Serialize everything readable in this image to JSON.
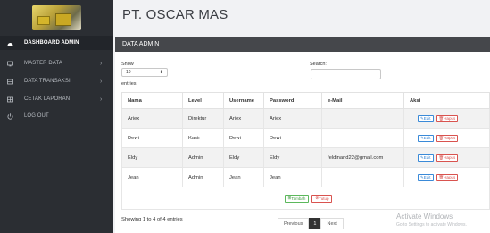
{
  "app": {
    "title": "PT. OSCAR MAS"
  },
  "sidebar": {
    "items": [
      {
        "label": "DASHBOARD ADMIN",
        "icon": "dashboard-icon",
        "active": true
      },
      {
        "label": "MASTER DATA",
        "icon": "monitor-icon",
        "has_submenu": true
      },
      {
        "label": "DATA TRANSAKSI",
        "icon": "table-icon",
        "has_submenu": true
      },
      {
        "label": "CETAK LAPORAN",
        "icon": "grid-icon",
        "has_submenu": true
      },
      {
        "label": "LOG OUT",
        "icon": "logout-icon"
      }
    ]
  },
  "panel": {
    "title": "DATA ADMIN",
    "show_label": "Show",
    "show_value": "10",
    "entries_label": "entries",
    "search_label": "Search:",
    "search_value": ""
  },
  "table": {
    "columns": [
      "Nama",
      "Level",
      "Username",
      "Password",
      "e-Mail",
      "Aksi"
    ],
    "rows": [
      {
        "nama": "Ariex",
        "level": "Direktur",
        "username": "Ariex",
        "password": "Ariex",
        "email": ""
      },
      {
        "nama": "Dewi",
        "level": "Kasir",
        "username": "Dewi",
        "password": "Dewi",
        "email": ""
      },
      {
        "nama": "Eldy",
        "level": "Admin",
        "username": "Eldy",
        "password": "Eldy",
        "email": "feldinand22@gmail.com"
      },
      {
        "nama": "Jean",
        "level": "Admin",
        "username": "Jean",
        "password": "Jean",
        "email": ""
      }
    ],
    "edit_label": "Edit",
    "delete_label": "Hapus",
    "add_label": "Tambah",
    "close_label": "Tutup"
  },
  "footer": {
    "info": "Showing 1 to 4 of 4 entries",
    "previous": "Previous",
    "current_page": "1",
    "next": "Next"
  },
  "watermark": {
    "line1": "Activate Windows",
    "line2": "Go to Settings to activate Windows."
  },
  "colors": {
    "sidebar_bg": "#2b2e33",
    "panel_header_bg": "#45474b",
    "edit_blue": "#2f7fd0",
    "delete_red": "#d9534f",
    "add_green": "#3c9a3c"
  }
}
